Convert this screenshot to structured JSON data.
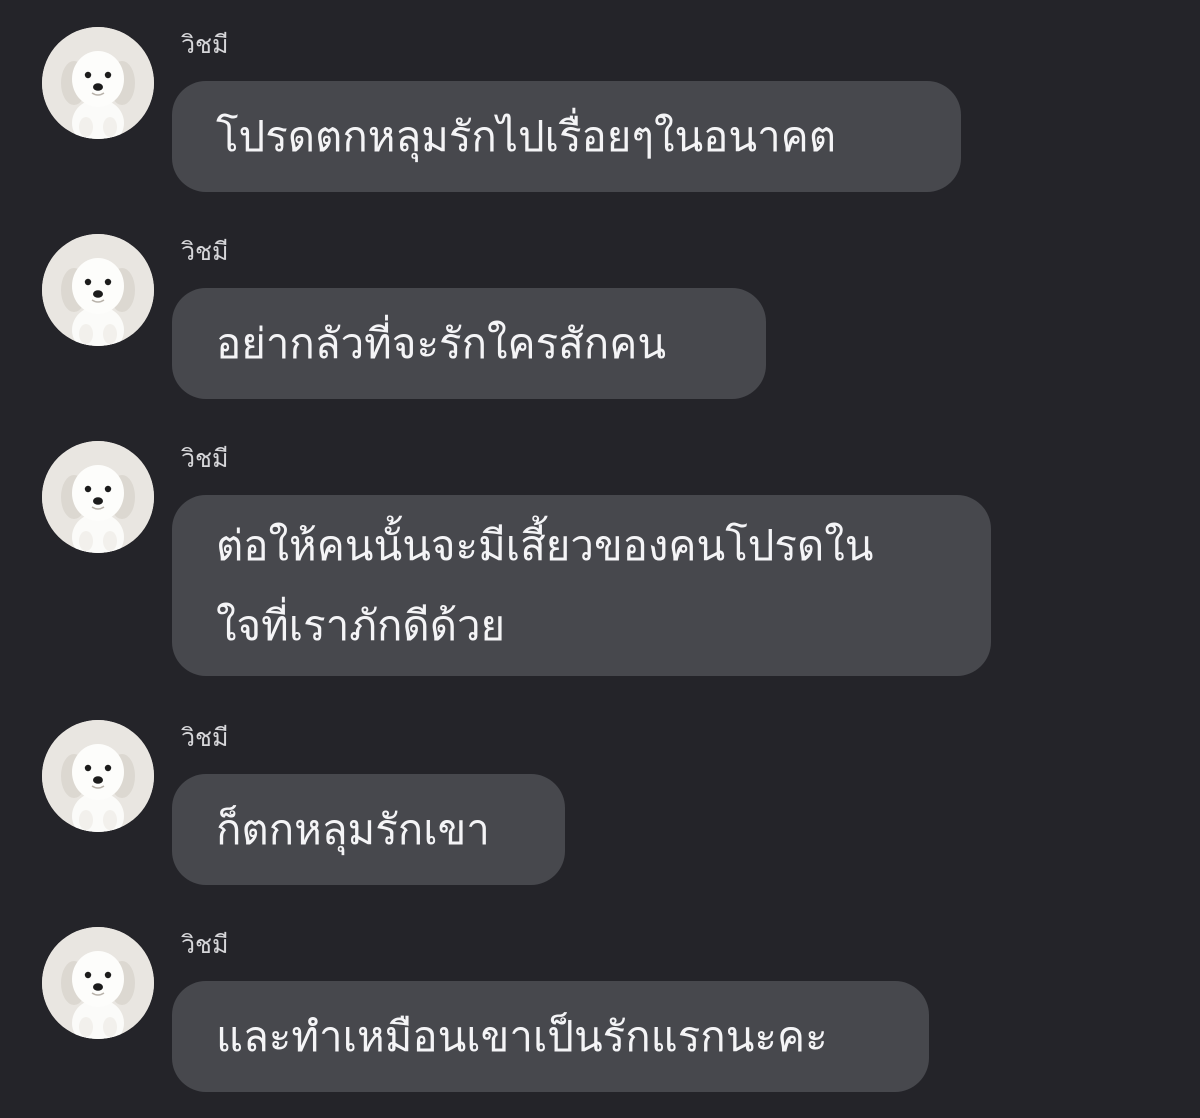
{
  "colors": {
    "background": "#242429",
    "bubble": "#47484d",
    "text": "#f4f4f6",
    "sender_name": "#d6d6d9"
  },
  "conversation": {
    "messages": [
      {
        "sender": "วิชมี",
        "avatar_icon": "white-dog-photo-icon",
        "text": "โปรดตกหลุมรักไปเรื่อยๆในอนาคต"
      },
      {
        "sender": "วิชมี",
        "avatar_icon": "white-dog-photo-icon",
        "text": "อย่ากลัวที่จะรักใครสักคน"
      },
      {
        "sender": "วิชมี",
        "avatar_icon": "white-dog-photo-icon",
        "text": "ต่อให้คนนั้นจะมีเสี้ยวของคนโปรดใน\nใจที่เราภักดีด้วย"
      },
      {
        "sender": "วิชมี",
        "avatar_icon": "white-dog-photo-icon",
        "text": "ก็ตกหลุมรักเขา"
      },
      {
        "sender": "วิชมี",
        "avatar_icon": "white-dog-photo-icon",
        "text": "และทำเหมือนเขาเป็นรักแรกนะคะ"
      }
    ]
  }
}
